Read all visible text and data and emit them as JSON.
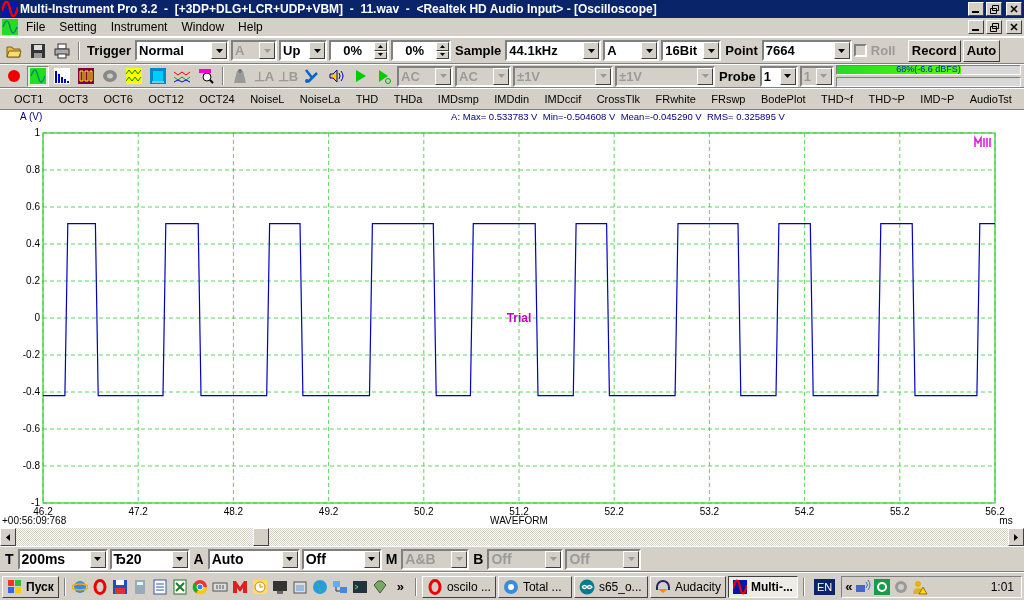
{
  "window": {
    "title": "Multi-Instrument Pro 3.2  -  [+3DP+DLG+LCR+UDP+VBM]  -  11.wav  -  <Realtek HD Audio Input> - [Oscilloscope]"
  },
  "menu": [
    "File",
    "Setting",
    "Instrument",
    "Window",
    "Help"
  ],
  "trigger_toolbar": {
    "items": [
      {
        "kind": "label",
        "text": "Trigger"
      },
      {
        "kind": "combo",
        "value": "Normal",
        "disabled": false
      },
      {
        "kind": "combo",
        "value": "A",
        "disabled": true
      },
      {
        "kind": "combo",
        "value": "Up",
        "disabled": false
      },
      {
        "kind": "spin",
        "value": "0%"
      },
      {
        "kind": "spin",
        "value": "0%"
      },
      {
        "kind": "label",
        "text": "Sample"
      },
      {
        "kind": "combo",
        "value": "44.1kHz",
        "disabled": false
      },
      {
        "kind": "combo",
        "value": "A",
        "disabled": false
      },
      {
        "kind": "combo",
        "value": "16Bit",
        "disabled": false
      },
      {
        "kind": "label",
        "text": "Point"
      },
      {
        "kind": "combo",
        "value": "7664",
        "disabled": false
      },
      {
        "kind": "checkbox",
        "label": "Roll",
        "checked": false,
        "disabled": true
      },
      {
        "kind": "button",
        "label": "Record"
      },
      {
        "kind": "button",
        "label": "Auto"
      }
    ]
  },
  "mode_toolbar": {
    "items": [
      {
        "kind": "icon",
        "selected": false
      },
      {
        "kind": "icon",
        "selected": true
      },
      {
        "kind": "icon",
        "selected": false
      },
      {
        "kind": "icon",
        "selected": false
      },
      {
        "kind": "icon",
        "selected": false
      },
      {
        "kind": "icon",
        "selected": false
      },
      {
        "kind": "icon",
        "selected": false
      },
      {
        "kind": "icon",
        "selected": false
      },
      {
        "kind": "icon",
        "selected": false
      },
      {
        "kind": "icon",
        "selected": false
      },
      {
        "kind": "glyph",
        "text": "⊥A",
        "disabled": true
      },
      {
        "kind": "glyph",
        "text": "⊥B",
        "disabled": true
      },
      {
        "kind": "icon",
        "selected": false
      },
      {
        "kind": "icon",
        "selected": false
      },
      {
        "kind": "icon",
        "selected": false
      },
      {
        "kind": "icon",
        "selected": false
      },
      {
        "kind": "combo",
        "value": "AC",
        "disabled": true
      },
      {
        "kind": "combo",
        "value": "AC",
        "disabled": true
      },
      {
        "kind": "combo",
        "value": "±1V",
        "disabled": true
      },
      {
        "kind": "combo",
        "value": "±1V",
        "disabled": true
      },
      {
        "kind": "label",
        "text": "Probe"
      },
      {
        "kind": "combo",
        "value": "1",
        "disabled": false
      },
      {
        "kind": "combo",
        "value": "1",
        "disabled": true
      },
      {
        "kind": "meter",
        "channels": [
          {
            "level": 0.68,
            "reading": "68%(-6.6 dBFS)"
          }
        ]
      }
    ]
  },
  "analyzers": [
    "OCT1",
    "OCT3",
    "OCT6",
    "OCT12",
    "OCT24",
    "NoiseL",
    "NoiseLa",
    "THD",
    "THDa",
    "IMDsmp",
    "IMDdin",
    "IMDccif",
    "CrossTlk",
    "FRwhite",
    "FRswp",
    "BodePlot",
    "THD~f",
    "THD~P",
    "IMD~P",
    "AudioTst"
  ],
  "scope": {
    "stats": "A: Max= 0.533783 V  Min=-0.504608 V  Mean=-0.045290 V  RMS= 0.325895 V",
    "trial_text": "Trial",
    "timestamp": "+00:56:09:768",
    "x_unit": "ms",
    "chart_data": {
      "type": "line",
      "grid": true,
      "ylabel": "A (V)",
      "xlabel": "WAVEFORM",
      "xlim": [
        46.2,
        56.2
      ],
      "ylim": [
        -1,
        1
      ],
      "xticks": [
        46.2,
        47.2,
        48.2,
        49.2,
        50.2,
        51.2,
        52.2,
        53.2,
        54.2,
        55.2,
        56.2
      ],
      "yticks": [
        1,
        0.8,
        0.6,
        0.4,
        0.2,
        0,
        -0.2,
        -0.4,
        -0.6,
        -0.8,
        -1
      ],
      "x": [
        46.2,
        46.43,
        46.46,
        46.75,
        46.78,
        47.46,
        47.49,
        47.83,
        47.86,
        48.55,
        48.58,
        48.9,
        48.93,
        49.63,
        49.66,
        50.3,
        50.33,
        50.69,
        50.72,
        51.37,
        51.4,
        51.77,
        51.8,
        52.12,
        52.15,
        52.84,
        52.87,
        53.5,
        53.53,
        53.9,
        53.93,
        54.26,
        54.29,
        54.97,
        55.0,
        55.33,
        55.36,
        56.01,
        56.04,
        56.2
      ],
      "series": [
        {
          "color": "#0000c0",
          "values": [
            -0.42,
            -0.42,
            0.51,
            0.51,
            -0.42,
            -0.42,
            0.51,
            0.51,
            -0.42,
            -0.42,
            0.51,
            0.51,
            -0.42,
            -0.42,
            0.51,
            0.51,
            -0.42,
            -0.42,
            0.51,
            0.51,
            -0.42,
            -0.42,
            0.51,
            0.51,
            -0.42,
            -0.42,
            0.51,
            0.51,
            -0.42,
            -0.42,
            0.51,
            0.51,
            -0.42,
            -0.42,
            0.51,
            0.51,
            -0.42,
            -0.42,
            0.51,
            0.51
          ]
        }
      ]
    }
  },
  "bottom_toolbar": {
    "items": [
      {
        "kind": "label",
        "text": "T"
      },
      {
        "kind": "combo",
        "value": "200ms",
        "disabled": false
      },
      {
        "kind": "combo",
        "value": "Ђ20",
        "disabled": false
      },
      {
        "kind": "label",
        "text": "A"
      },
      {
        "kind": "combo",
        "value": "Auto",
        "disabled": false
      },
      {
        "kind": "combo",
        "value": "Off",
        "disabled": false
      },
      {
        "kind": "label",
        "text": "M"
      },
      {
        "kind": "combo",
        "value": "A&B",
        "disabled": true
      },
      {
        "kind": "label",
        "text": "B"
      },
      {
        "kind": "combo",
        "value": "Off",
        "disabled": true
      },
      {
        "kind": "combo",
        "value": "Off",
        "disabled": true
      }
    ]
  },
  "taskbar": {
    "start": "Пуск",
    "overflow": "»",
    "tasks": [
      {
        "label": "oscilo ...",
        "selected": false
      },
      {
        "label": "Total ...",
        "selected": false
      },
      {
        "label": "s65_o...",
        "selected": false
      },
      {
        "label": "Audacity",
        "selected": false
      },
      {
        "label": "Multi-...",
        "selected": true
      }
    ],
    "language": "EN",
    "tray_expand": "«",
    "clock": "1:01"
  }
}
